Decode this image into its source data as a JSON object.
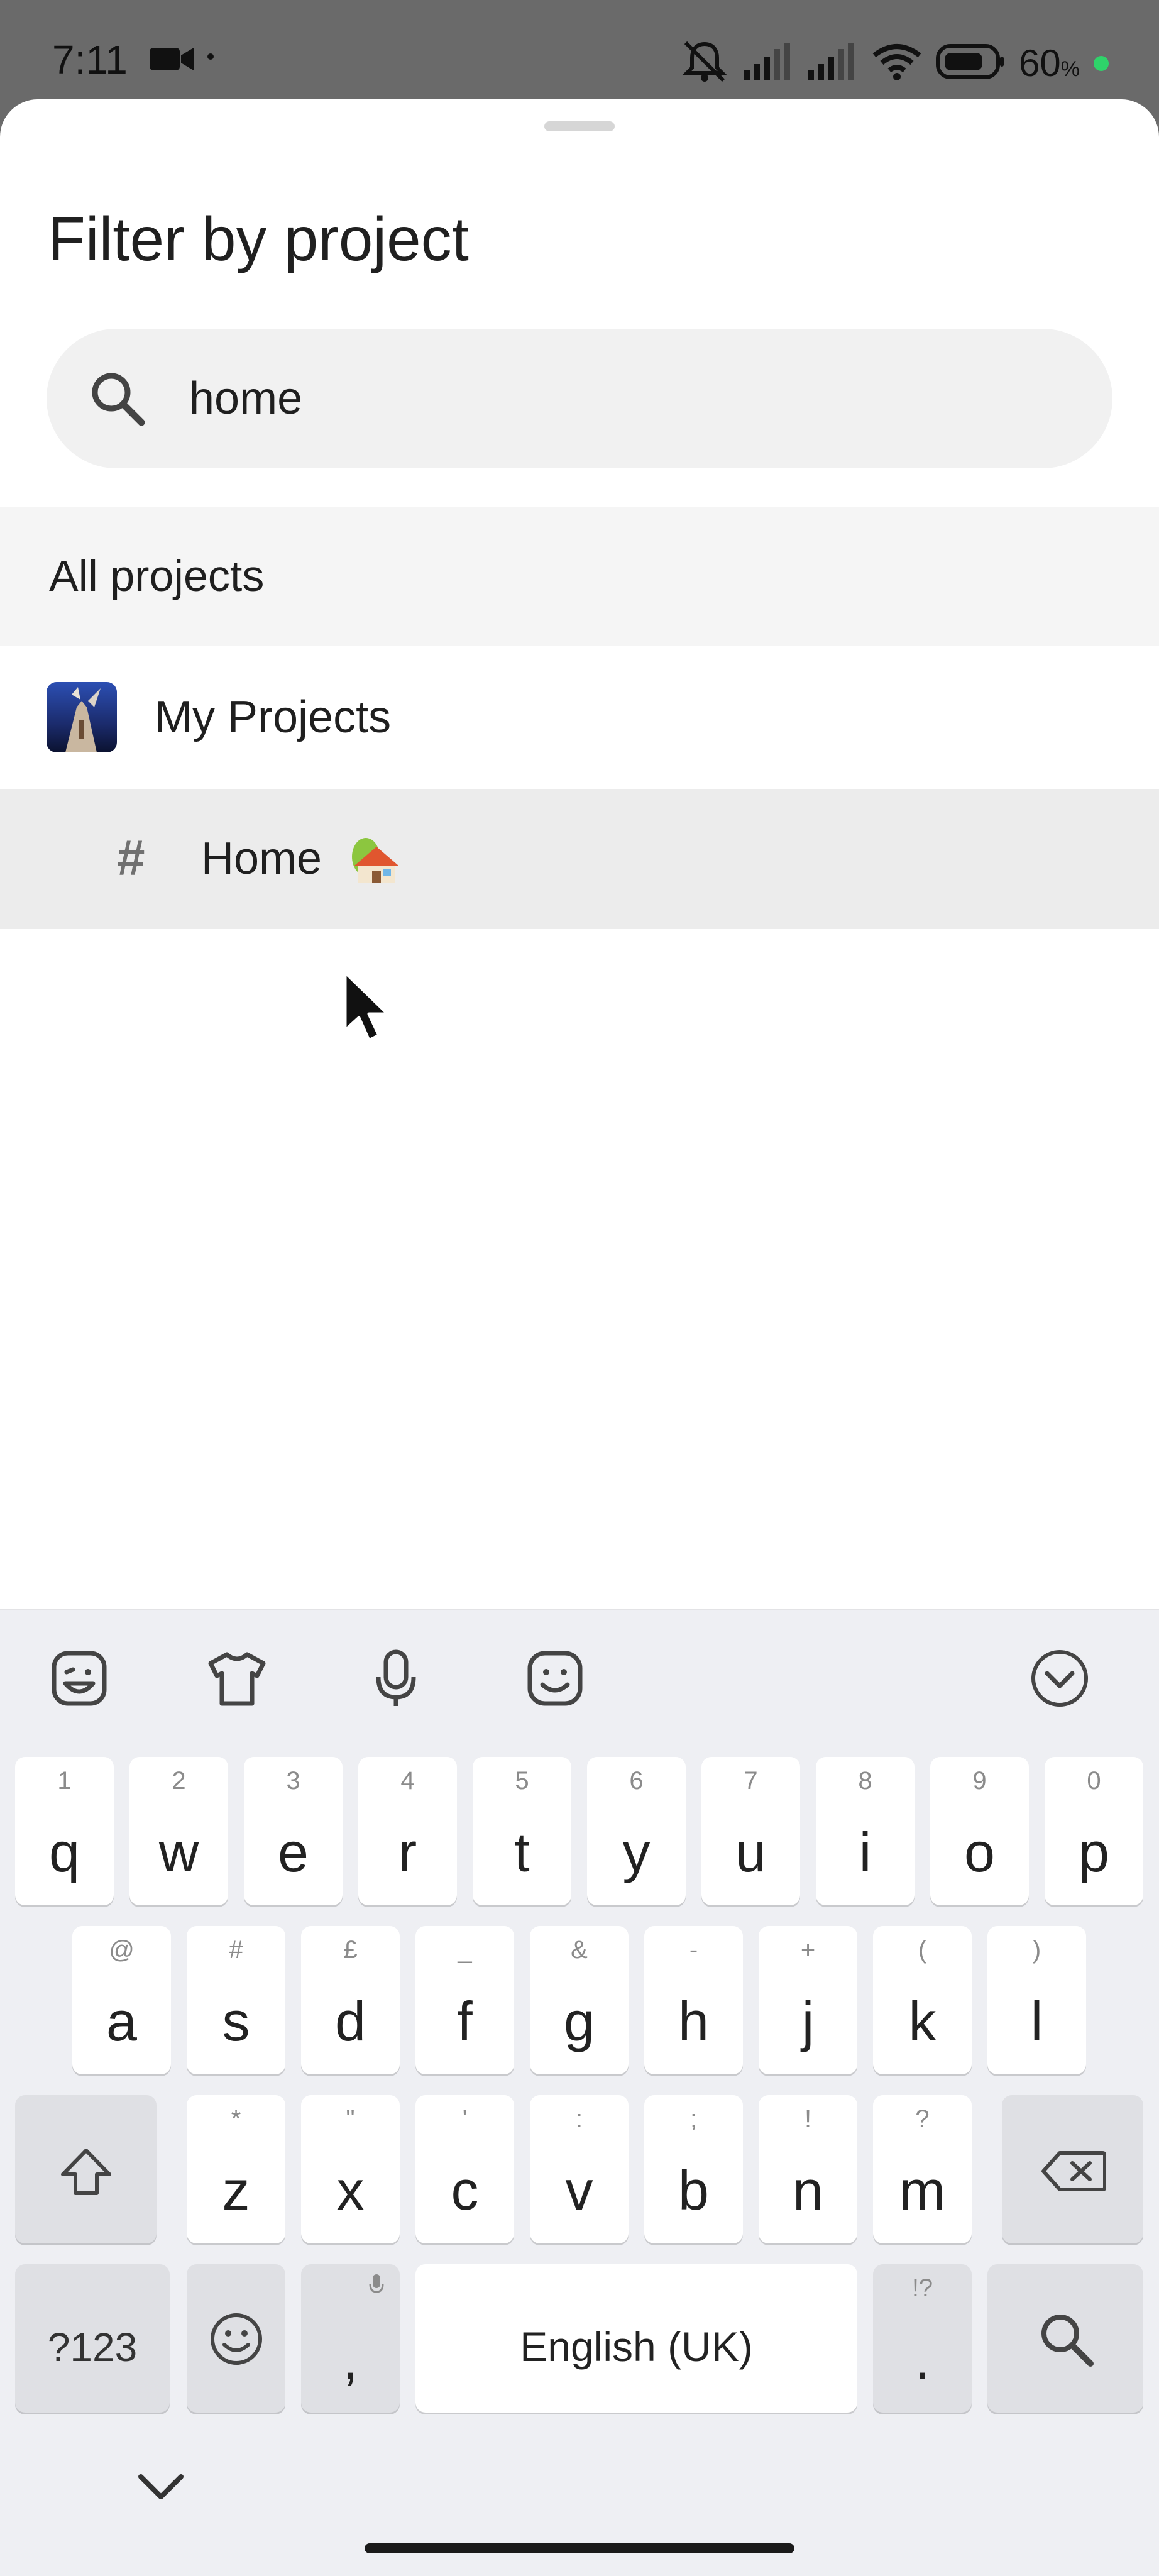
{
  "status_bar": {
    "time": "7:11",
    "battery_percent": "60",
    "battery_symbol": "%"
  },
  "sheet": {
    "title": "Filter by project",
    "search": {
      "value": "home",
      "placeholder": ""
    },
    "all_projects_label": "All projects",
    "items": [
      {
        "label": "My Projects",
        "icon": "project-avatar"
      },
      {
        "label": "Home",
        "icon": "hash-icon",
        "emoji": "house-icon",
        "highlighted": true
      }
    ]
  },
  "keyboard": {
    "toolbar_icons": [
      "sticker-icon",
      "theme-icon",
      "mic-icon",
      "emoji-face-icon",
      "collapse-icon"
    ],
    "row1": [
      {
        "k": "q",
        "h": "1"
      },
      {
        "k": "w",
        "h": "2"
      },
      {
        "k": "e",
        "h": "3"
      },
      {
        "k": "r",
        "h": "4"
      },
      {
        "k": "t",
        "h": "5"
      },
      {
        "k": "y",
        "h": "6"
      },
      {
        "k": "u",
        "h": "7"
      },
      {
        "k": "i",
        "h": "8"
      },
      {
        "k": "o",
        "h": "9"
      },
      {
        "k": "p",
        "h": "0"
      }
    ],
    "row2": [
      {
        "k": "a",
        "h": "@"
      },
      {
        "k": "s",
        "h": "#"
      },
      {
        "k": "d",
        "h": "£"
      },
      {
        "k": "f",
        "h": "_"
      },
      {
        "k": "g",
        "h": "&"
      },
      {
        "k": "h",
        "h": "-"
      },
      {
        "k": "j",
        "h": "+"
      },
      {
        "k": "k",
        "h": "("
      },
      {
        "k": "l",
        "h": ")"
      }
    ],
    "row3": [
      {
        "k": "z",
        "h": "*"
      },
      {
        "k": "x",
        "h": "\""
      },
      {
        "k": "c",
        "h": "'"
      },
      {
        "k": "v",
        "h": ":"
      },
      {
        "k": "b",
        "h": ";"
      },
      {
        "k": "n",
        "h": "!"
      },
      {
        "k": "m",
        "h": "?"
      }
    ],
    "symbols_label": "?123",
    "comma_label": ",",
    "space_label": "English (UK)",
    "period_label": ".",
    "period_hint": "!?"
  },
  "colors": {
    "accent_green": "#2fd36a",
    "row_highlight": "#ececec"
  }
}
